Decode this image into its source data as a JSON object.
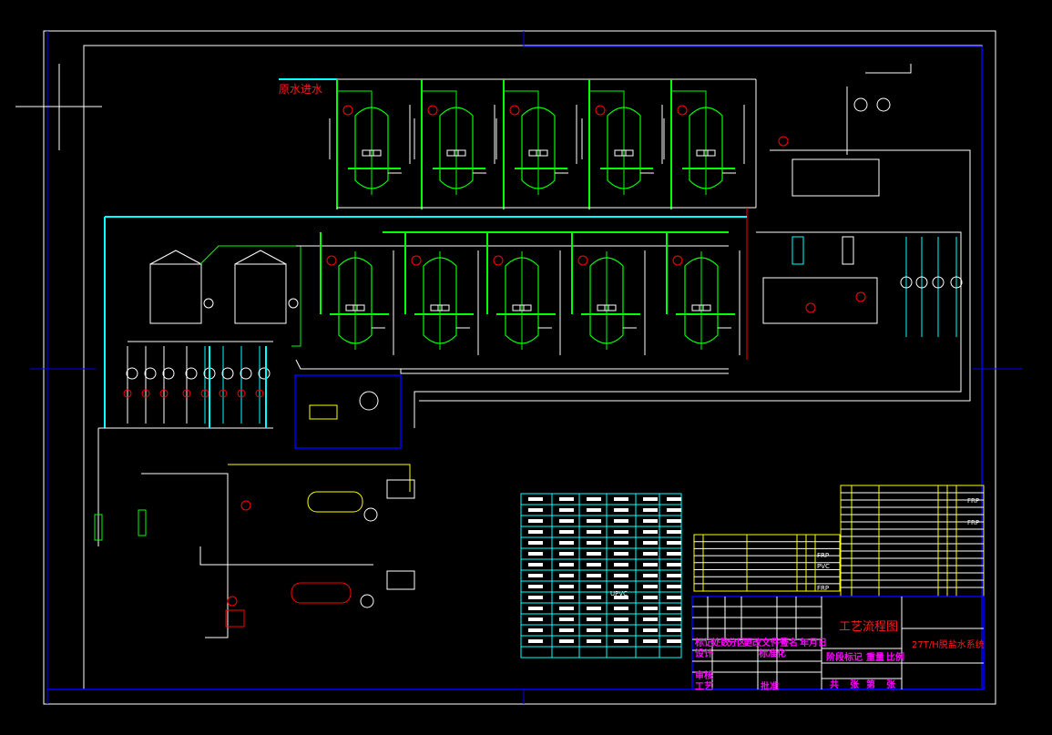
{
  "drawing": {
    "inlet_label": "原水进水",
    "title": "工艺流程图",
    "system_name": "27T/H脱盐水系统",
    "colors": {
      "background": "#000000",
      "frame": "#ffffff",
      "border": "#0000ff",
      "pipe_green": "#00ff00",
      "pipe_cyan": "#00ffff",
      "pipe_red": "#ff0000",
      "pipe_yellow": "#ffff00",
      "annotation": "#ff00ff"
    }
  },
  "title_block": {
    "revision_headers": [
      "标记",
      "处数",
      "分区",
      "更改文件号",
      "签名",
      "年月日"
    ],
    "design": "设计",
    "standardization": "标准化",
    "review": "审核",
    "process": "工艺",
    "approve": "批准",
    "stage_mark": "阶段标记",
    "weight": "重量",
    "scale": "比例",
    "sheets": [
      "共",
      "张",
      "第",
      "张"
    ]
  },
  "parts_list": {
    "materials": [
      "FRP",
      "FRP",
      "FRP",
      "PVC",
      "FRP"
    ]
  },
  "legend": {
    "rows": 15,
    "cols": 6,
    "samples": [
      "UPVC"
    ]
  }
}
